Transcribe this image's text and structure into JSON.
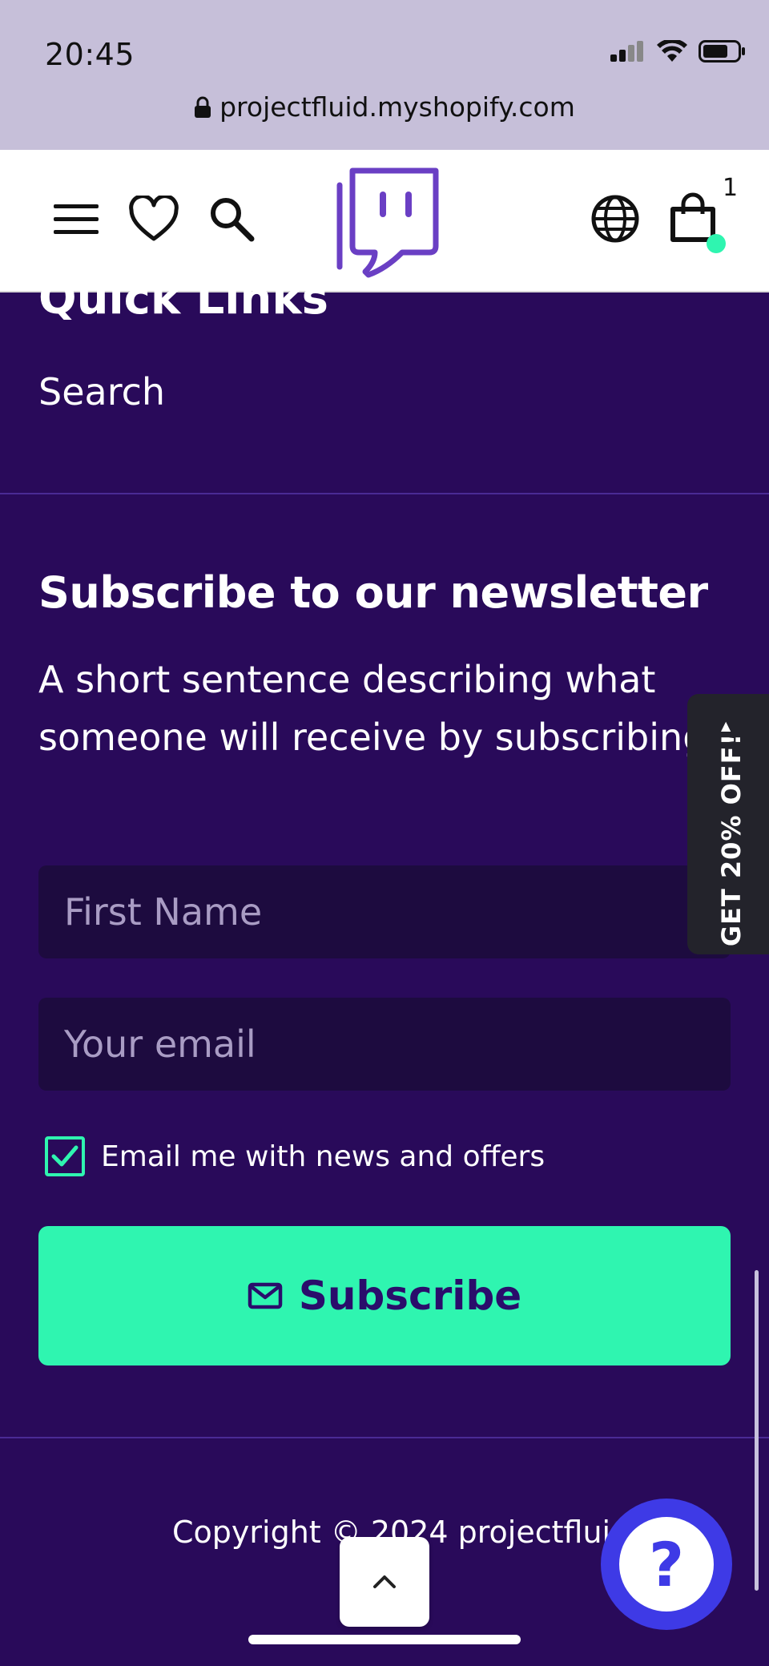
{
  "status_bar": {
    "time": "20:45"
  },
  "browser": {
    "url": "projectfluid.myshopify.com"
  },
  "header": {
    "cart_count": "1",
    "icons": [
      "menu-icon",
      "heart-icon",
      "search-icon",
      "logo",
      "globe-icon",
      "shopping-bag-icon"
    ]
  },
  "footer": {
    "quick_links_title": "Quick Links",
    "quick_links": [
      "Search"
    ],
    "newsletter": {
      "title": "Subscribe to our newsletter",
      "description": "A short sentence describing what someone will receive by subscribing",
      "first_name_placeholder": "First Name",
      "email_placeholder": "Your email",
      "checkbox_label": "Email me with news and offers",
      "checkbox_checked": true,
      "subscribe_label": "Subscribe"
    },
    "copyright": "Copyright © 2024 projectfluid"
  },
  "promo_tab": {
    "label": "GET 20% OFF!"
  },
  "help": {
    "label": "?"
  },
  "colors": {
    "background": "#290a5a",
    "accent": "#2ff5b0",
    "brand": "#6a3fc4",
    "help": "#3e3ae6"
  }
}
